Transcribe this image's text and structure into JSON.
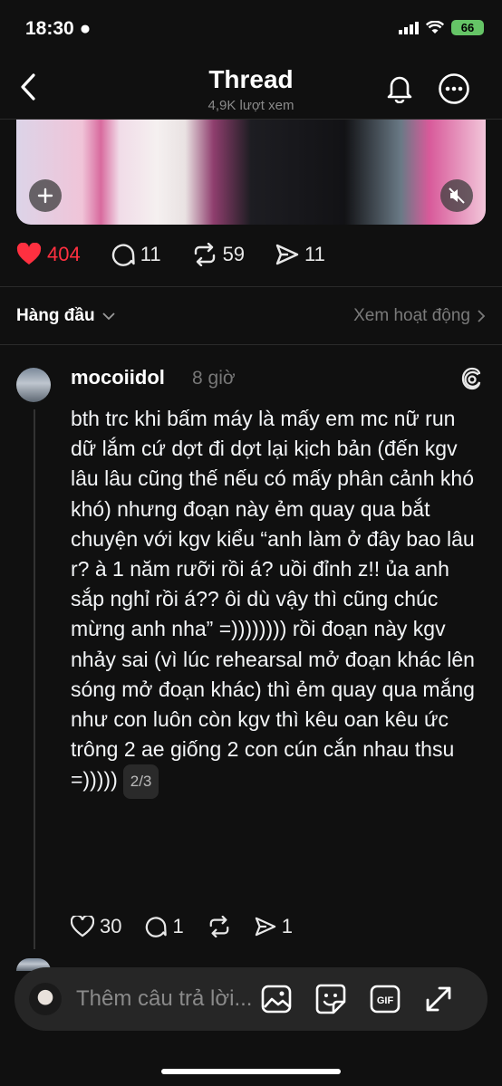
{
  "status": {
    "time": "18:30",
    "battery": "66"
  },
  "header": {
    "title": "Thread",
    "views": "4,9K lượt xem"
  },
  "post_stats": {
    "likes": "404",
    "comments": "11",
    "reposts": "59",
    "shares": "11"
  },
  "sort": {
    "label": "Hàng đầu",
    "activity": "Xem hoạt động"
  },
  "reply": {
    "username": "mocoiidol",
    "time": "8 giờ",
    "body": "bth trc khi bấm máy là mấy em mc nữ run dữ lắm cứ dợt đi dợt lại kịch bản (đến kgv lâu lâu cũng thế nếu có mấy phân cảnh khó khó) nhưng đoạn này ẻm quay qua bắt chuyện với kgv kiểu “anh làm ở đây bao lâu r? à 1 năm rưỡi rồi á? uồi đỉnh z!! ủa anh sắp nghỉ rồi á?? ôi dù vậy thì cũng chúc mừng anh nha” =)))))))) rồi đoạn này kgv nhảy sai (vì lúc rehearsal mở đoạn khác lên sóng mở đoạn khác) thì ẻm quay qua mắng như con luôn còn kgv thì kêu oan kêu ức trông 2 ae giống 2 con cún cắn nhau thsu =)))))",
    "page": "2/3",
    "likes": "30",
    "comments": "1",
    "shares": "1"
  },
  "reply_bar": {
    "placeholder": "Thêm câu trả lời..."
  },
  "icons": [
    "back-icon",
    "bell-icon",
    "more-icon",
    "add-icon",
    "mute-icon",
    "heart-icon",
    "comment-icon",
    "repost-icon",
    "share-icon",
    "threads-icon",
    "image-icon",
    "sticker-icon",
    "gif-icon",
    "expand-icon"
  ],
  "colors": {
    "like": "#ff3040",
    "background": "#101010"
  }
}
